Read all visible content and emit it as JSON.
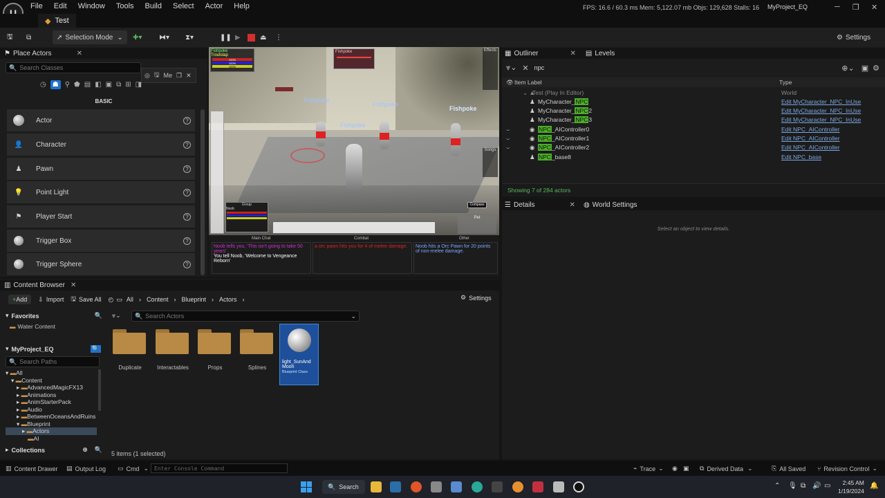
{
  "menubar": {
    "items": [
      "File",
      "Edit",
      "Window",
      "Tools",
      "Build",
      "Select",
      "Actor",
      "Help"
    ],
    "stats": "FPS: 16.6 / 60.3 ms  Mem: 5,122.07 mb  Objs: 129,628  Stalls: 16",
    "project": "MyProject_EQ"
  },
  "tab": {
    "level": "Test"
  },
  "toolbar": {
    "mode": "Selection Mode",
    "settings": "Settings"
  },
  "place": {
    "title": "Place Actors",
    "search_placeholder": "Search Classes",
    "category": "BASIC",
    "popup": "Me",
    "items": [
      "Actor",
      "Character",
      "Pawn",
      "Point Light",
      "Player Start",
      "Trigger Box",
      "Trigger Sphere"
    ]
  },
  "viewport": {
    "labels": [
      "Fishpoke",
      "Fishpoke",
      "Fishpoke",
      "Fishpoke"
    ],
    "target": "Fishpoke",
    "group_title": "Fishpoke",
    "group_sub": "Troutslap",
    "group_pct": [
      "100%",
      "100%",
      "100%"
    ],
    "group_window": "Group",
    "group_member": "Noob",
    "effects": "Effects",
    "songs": "Songs",
    "compass": "Compass",
    "pet": "Pet",
    "chat_tabs": [
      "Main Chat",
      "Combat",
      "Other"
    ],
    "chat1_a": "Noob tells you, 'This isn't going to take 50 years'",
    "chat1_b": "You tell Noob, 'Welcome to Vengeance Reborn'",
    "chat2": "a orc pawn hits you for 4 of melee damage.",
    "chat3": "Noob hits a Orc Pawn for 20 points of non-melee damage."
  },
  "outliner": {
    "title": "Outliner",
    "levels": "Levels",
    "filter": "npc",
    "col_label": "Item Label",
    "col_type": "Type",
    "root": "Test (Play In Editor)",
    "root_type": "World",
    "rows": [
      {
        "pre": "MyCharacter_",
        "hl": "NPC",
        "post": "",
        "type": "Edit MyCharacter_NPC_InUse"
      },
      {
        "pre": "MyCharacter_",
        "hl": "NPC",
        "post": "2",
        "type": "Edit MyCharacter_NPC_InUse"
      },
      {
        "pre": "MyCharacter_",
        "hl": "NPC",
        "post": "3",
        "type": "Edit MyCharacter_NPC_InUse"
      },
      {
        "pre": "",
        "hl": "NPC",
        "post": "_AIController0",
        "type": "Edit NPC_AIController"
      },
      {
        "pre": "",
        "hl": "NPC",
        "post": "_AIController1",
        "type": "Edit NPC_AIController"
      },
      {
        "pre": "",
        "hl": "NPC",
        "post": "_AIController2",
        "type": "Edit NPC_AIController"
      },
      {
        "pre": "",
        "hl": "NPC",
        "post": "_base8",
        "type": "Edit NPC_base"
      }
    ],
    "footer": "Showing 7 of 284 actors"
  },
  "details": {
    "title": "Details",
    "world": "World Settings",
    "empty": "Select an object to view details."
  },
  "content": {
    "title": "Content Browser",
    "add": "Add",
    "import": "Import",
    "save_all": "Save All",
    "crumbs": [
      "All",
      "Content",
      "Blueprint",
      "Actors"
    ],
    "settings": "Settings",
    "favorites": "Favorites",
    "water": "Water Content",
    "project": "MyProject_EQ",
    "search_paths": "Search Paths",
    "search_actors": "Search Actors",
    "tree": [
      "All",
      "Content",
      "AdvancedMagicFX13",
      "Animations",
      "AnimStarterPack",
      "Audio",
      "BetweenOceansAndRuins",
      "Blueprint",
      "Actors",
      "AI"
    ],
    "folders": [
      "Duplicate",
      "Interactables",
      "Props",
      "Splines"
    ],
    "asset_name": "light_SunAnd Moon",
    "asset_type": "Blueprint Class",
    "count": "5 items (1 selected)",
    "collections": "Collections"
  },
  "status": {
    "drawer": "Content Drawer",
    "output": "Output Log",
    "cmd": "Cmd",
    "console": "Enter Console Command",
    "trace": "Trace",
    "derived": "Derived Data",
    "saved": "All Saved",
    "revision": "Revision Control"
  },
  "taskbar": {
    "search": "Search",
    "time": "2:45 AM",
    "date": "1/19/2024"
  }
}
